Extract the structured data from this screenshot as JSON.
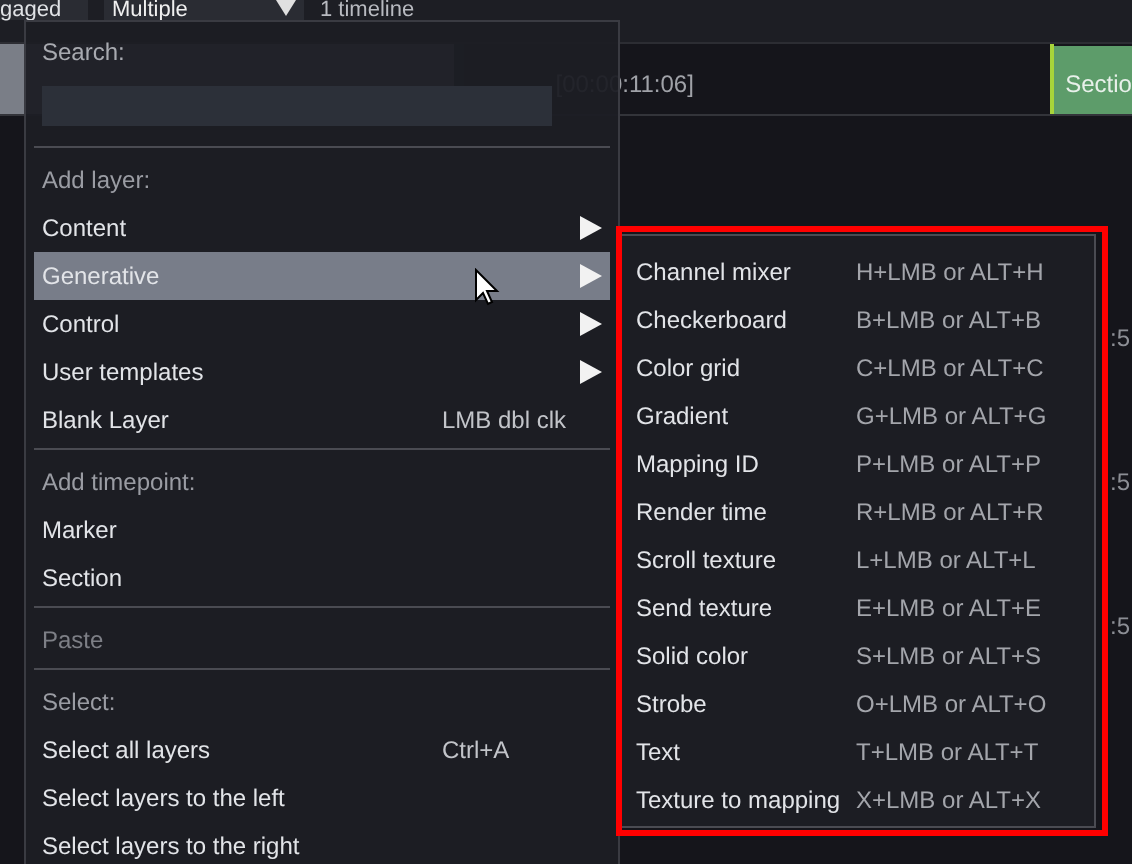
{
  "top_bar": {
    "mode": "gaged",
    "dropdown": "Multiple",
    "timeline_count": "1 timeline"
  },
  "timeline": {
    "timecode": "[00:00:11:06]",
    "section": "Sectio",
    "right_labels": [
      ":5",
      ":5",
      ":5"
    ]
  },
  "menu": {
    "search": {
      "label": "Search:"
    },
    "groups": [
      {
        "header": "Add layer:",
        "items": [
          {
            "label": "Content",
            "has_submenu": true,
            "selected": false,
            "disabled": false
          },
          {
            "label": "Generative",
            "has_submenu": true,
            "selected": true,
            "disabled": false
          },
          {
            "label": "Control",
            "has_submenu": true,
            "selected": false,
            "disabled": false
          },
          {
            "label": "User templates",
            "has_submenu": true,
            "selected": false,
            "disabled": false
          },
          {
            "label": "Blank Layer",
            "shortcut": "LMB dbl clk",
            "has_submenu": false,
            "selected": false,
            "disabled": false
          }
        ]
      },
      {
        "header": "Add timepoint:",
        "items": [
          {
            "label": "Marker",
            "has_submenu": false,
            "selected": false,
            "disabled": false
          },
          {
            "label": "Section",
            "has_submenu": false,
            "selected": false,
            "disabled": false
          }
        ]
      },
      {
        "items": [
          {
            "label": "Paste",
            "has_submenu": false,
            "selected": false,
            "disabled": true
          }
        ]
      },
      {
        "header": "Select:",
        "items": [
          {
            "label": "Select all layers",
            "shortcut": "Ctrl+A",
            "has_submenu": false,
            "selected": false,
            "disabled": false
          },
          {
            "label": "Select layers to the left",
            "has_submenu": false,
            "selected": false,
            "disabled": false
          },
          {
            "label": "Select layers to the right",
            "has_submenu": false,
            "selected": false,
            "disabled": false
          }
        ]
      }
    ]
  },
  "submenu": {
    "highlighted": true,
    "items": [
      {
        "label": "Channel mixer",
        "shortcut": "H+LMB or ALT+H"
      },
      {
        "label": "Checkerboard",
        "shortcut": "B+LMB or ALT+B"
      },
      {
        "label": "Color grid",
        "shortcut": "C+LMB or ALT+C"
      },
      {
        "label": "Gradient",
        "shortcut": "G+LMB or ALT+G"
      },
      {
        "label": "Mapping ID",
        "shortcut": "P+LMB or ALT+P"
      },
      {
        "label": "Render time",
        "shortcut": "R+LMB or ALT+R"
      },
      {
        "label": "Scroll texture",
        "shortcut": "L+LMB or ALT+L"
      },
      {
        "label": "Send texture",
        "shortcut": "E+LMB or ALT+E"
      },
      {
        "label": "Solid color",
        "shortcut": "S+LMB or ALT+S"
      },
      {
        "label": "Strobe",
        "shortcut": "O+LMB or ALT+O"
      },
      {
        "label": "Text",
        "shortcut": "T+LMB or ALT+T"
      },
      {
        "label": "Texture to mapping",
        "shortcut": "X+LMB or ALT+X"
      }
    ]
  }
}
